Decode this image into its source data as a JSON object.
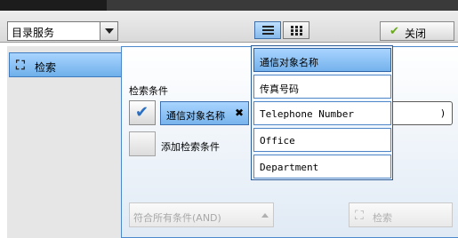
{
  "header": {
    "service_select": "目录服务",
    "close_label": "关闭"
  },
  "sidebar": {
    "tab_search": "检索"
  },
  "main": {
    "criteria_title": "检索条件",
    "criteria_item": "通信对象名称",
    "remove_mark": "✖",
    "add_criteria": "添加检索条件",
    "value_tail": ")",
    "match_mode": "符合所有条件(AND)",
    "search_button": "检索"
  },
  "dropdown": {
    "items": [
      {
        "label": "通信对象名称",
        "selected": true
      },
      {
        "label": "传真号码",
        "selected": false
      },
      {
        "label": "Telephone Number",
        "selected": false
      },
      {
        "label": "Office",
        "selected": false
      },
      {
        "label": "Department",
        "selected": false
      }
    ]
  },
  "colors": {
    "accent_blue": "#78b4ec",
    "border_blue": "#3b6fb0",
    "checkmark_green": "#6aa81c"
  }
}
